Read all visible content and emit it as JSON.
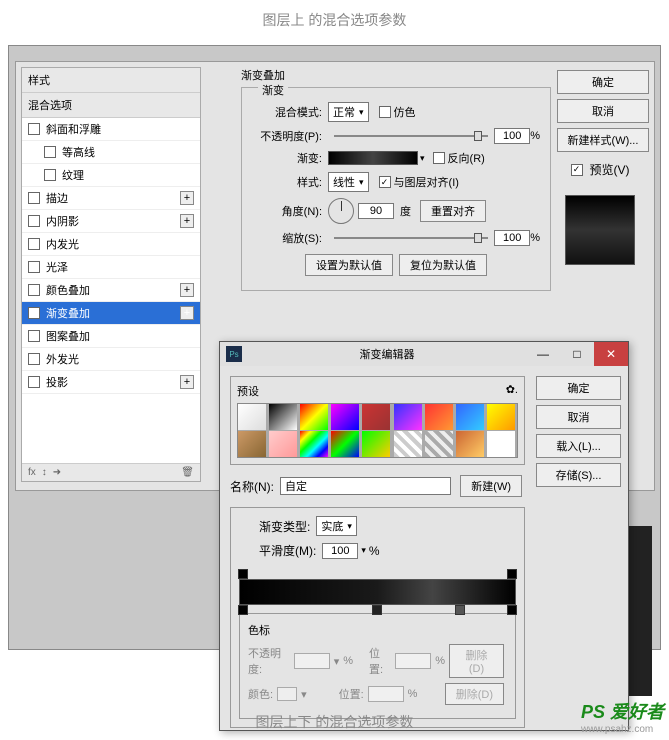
{
  "caption_top": "图层上   的混合选项参数",
  "caption_bottom": "图层上下  的混合选项参数",
  "watermark": {
    "brand": "PS 爱好者",
    "url": "www.psahz.com"
  },
  "styles": {
    "header": "样式",
    "subheader": "混合选项",
    "items": [
      {
        "label": "斜面和浮雕",
        "checked": false,
        "plus": false,
        "indent": false
      },
      {
        "label": "等高线",
        "checked": false,
        "plus": false,
        "indent": true
      },
      {
        "label": "纹理",
        "checked": false,
        "plus": false,
        "indent": true
      },
      {
        "label": "描边",
        "checked": false,
        "plus": true,
        "indent": false
      },
      {
        "label": "内阴影",
        "checked": false,
        "plus": true,
        "indent": false
      },
      {
        "label": "内发光",
        "checked": false,
        "plus": false,
        "indent": false
      },
      {
        "label": "光泽",
        "checked": false,
        "plus": false,
        "indent": false
      },
      {
        "label": "颜色叠加",
        "checked": false,
        "plus": true,
        "indent": false
      },
      {
        "label": "渐变叠加",
        "checked": true,
        "plus": true,
        "indent": false,
        "selected": true
      },
      {
        "label": "图案叠加",
        "checked": false,
        "plus": false,
        "indent": false
      },
      {
        "label": "外发光",
        "checked": false,
        "plus": false,
        "indent": false
      },
      {
        "label": "投影",
        "checked": false,
        "plus": true,
        "indent": false
      }
    ],
    "footer": "fx"
  },
  "gradient": {
    "title": "渐变叠加",
    "subtitle": "渐变",
    "blend_mode_label": "混合模式:",
    "blend_mode": "正常",
    "dither_label": "仿色",
    "opacity_label": "不透明度(P):",
    "opacity": "100",
    "pct": "%",
    "gradient_label": "渐变:",
    "reverse_label": "反向(R)",
    "style_label": "样式:",
    "style": "线性",
    "align_label": "与图层对齐(I)",
    "angle_label": "角度(N):",
    "angle": "90",
    "angle_unit": "度",
    "reset_align": "重置对齐",
    "scale_label": "缩放(S):",
    "scale": "100",
    "set_default": "设置为默认值",
    "reset_default": "复位为默认值"
  },
  "right": {
    "ok": "确定",
    "cancel": "取消",
    "new_style": "新建样式(W)...",
    "preview": "预览(V)"
  },
  "editor": {
    "title": "渐变编辑器",
    "presets_label": "预设",
    "gear": "✿.",
    "ok": "确定",
    "cancel": "取消",
    "load": "载入(L)...",
    "save": "存储(S)...",
    "name_label": "名称(N):",
    "name": "自定",
    "new_btn": "新建(W)",
    "type_label": "渐变类型:",
    "type": "实底",
    "smooth_label": "平滑度(M):",
    "smooth": "100",
    "pct": "%",
    "stops_label": "色标",
    "opacity_label": "不透明度:",
    "loc_label": "位置:",
    "delete": "删除(D)",
    "color_label": "颜色:"
  },
  "preset_colors": [
    "linear-gradient(135deg,#fff,#ddd)",
    "linear-gradient(135deg,#000,#fff)",
    "linear-gradient(135deg,#f00,#ff0,#0f0)",
    "linear-gradient(135deg,#f0f,#00f)",
    "linear-gradient(135deg,#c33,#933)",
    "linear-gradient(135deg,#33f,#f3f)",
    "linear-gradient(135deg,#f33,#f93)",
    "linear-gradient(135deg,#36f,#3cf)",
    "linear-gradient(135deg,#ff0,#f90)",
    "linear-gradient(135deg,#c96,#863)",
    "linear-gradient(135deg,#fcc,#f99)",
    "linear-gradient(135deg,#f00,#ff0,#0f0,#0ff,#00f,#f0f)",
    "linear-gradient(135deg,#f00,#0f0,#00f)",
    "linear-gradient(135deg,#0f0,#fc0)",
    "repeating-linear-gradient(45deg,#ccc 0 4px,#fff 4px 8px)",
    "repeating-linear-gradient(45deg,#aaa 0 4px,#eee 4px 8px)",
    "linear-gradient(135deg,#c63,#fc6)",
    "#fff"
  ]
}
